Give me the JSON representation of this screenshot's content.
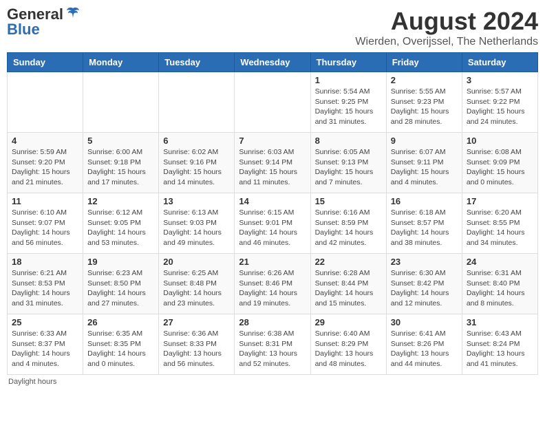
{
  "header": {
    "logo_general": "General",
    "logo_blue": "Blue",
    "title": "August 2024",
    "subtitle": "Wierden, Overijssel, The Netherlands"
  },
  "calendar": {
    "days_of_week": [
      "Sunday",
      "Monday",
      "Tuesday",
      "Wednesday",
      "Thursday",
      "Friday",
      "Saturday"
    ],
    "weeks": [
      [
        {
          "day": "",
          "info": ""
        },
        {
          "day": "",
          "info": ""
        },
        {
          "day": "",
          "info": ""
        },
        {
          "day": "",
          "info": ""
        },
        {
          "day": "1",
          "info": "Sunrise: 5:54 AM\nSunset: 9:25 PM\nDaylight: 15 hours\nand 31 minutes."
        },
        {
          "day": "2",
          "info": "Sunrise: 5:55 AM\nSunset: 9:23 PM\nDaylight: 15 hours\nand 28 minutes."
        },
        {
          "day": "3",
          "info": "Sunrise: 5:57 AM\nSunset: 9:22 PM\nDaylight: 15 hours\nand 24 minutes."
        }
      ],
      [
        {
          "day": "4",
          "info": "Sunrise: 5:59 AM\nSunset: 9:20 PM\nDaylight: 15 hours\nand 21 minutes."
        },
        {
          "day": "5",
          "info": "Sunrise: 6:00 AM\nSunset: 9:18 PM\nDaylight: 15 hours\nand 17 minutes."
        },
        {
          "day": "6",
          "info": "Sunrise: 6:02 AM\nSunset: 9:16 PM\nDaylight: 15 hours\nand 14 minutes."
        },
        {
          "day": "7",
          "info": "Sunrise: 6:03 AM\nSunset: 9:14 PM\nDaylight: 15 hours\nand 11 minutes."
        },
        {
          "day": "8",
          "info": "Sunrise: 6:05 AM\nSunset: 9:13 PM\nDaylight: 15 hours\nand 7 minutes."
        },
        {
          "day": "9",
          "info": "Sunrise: 6:07 AM\nSunset: 9:11 PM\nDaylight: 15 hours\nand 4 minutes."
        },
        {
          "day": "10",
          "info": "Sunrise: 6:08 AM\nSunset: 9:09 PM\nDaylight: 15 hours\nand 0 minutes."
        }
      ],
      [
        {
          "day": "11",
          "info": "Sunrise: 6:10 AM\nSunset: 9:07 PM\nDaylight: 14 hours\nand 56 minutes."
        },
        {
          "day": "12",
          "info": "Sunrise: 6:12 AM\nSunset: 9:05 PM\nDaylight: 14 hours\nand 53 minutes."
        },
        {
          "day": "13",
          "info": "Sunrise: 6:13 AM\nSunset: 9:03 PM\nDaylight: 14 hours\nand 49 minutes."
        },
        {
          "day": "14",
          "info": "Sunrise: 6:15 AM\nSunset: 9:01 PM\nDaylight: 14 hours\nand 46 minutes."
        },
        {
          "day": "15",
          "info": "Sunrise: 6:16 AM\nSunset: 8:59 PM\nDaylight: 14 hours\nand 42 minutes."
        },
        {
          "day": "16",
          "info": "Sunrise: 6:18 AM\nSunset: 8:57 PM\nDaylight: 14 hours\nand 38 minutes."
        },
        {
          "day": "17",
          "info": "Sunrise: 6:20 AM\nSunset: 8:55 PM\nDaylight: 14 hours\nand 34 minutes."
        }
      ],
      [
        {
          "day": "18",
          "info": "Sunrise: 6:21 AM\nSunset: 8:53 PM\nDaylight: 14 hours\nand 31 minutes."
        },
        {
          "day": "19",
          "info": "Sunrise: 6:23 AM\nSunset: 8:50 PM\nDaylight: 14 hours\nand 27 minutes."
        },
        {
          "day": "20",
          "info": "Sunrise: 6:25 AM\nSunset: 8:48 PM\nDaylight: 14 hours\nand 23 minutes."
        },
        {
          "day": "21",
          "info": "Sunrise: 6:26 AM\nSunset: 8:46 PM\nDaylight: 14 hours\nand 19 minutes."
        },
        {
          "day": "22",
          "info": "Sunrise: 6:28 AM\nSunset: 8:44 PM\nDaylight: 14 hours\nand 15 minutes."
        },
        {
          "day": "23",
          "info": "Sunrise: 6:30 AM\nSunset: 8:42 PM\nDaylight: 14 hours\nand 12 minutes."
        },
        {
          "day": "24",
          "info": "Sunrise: 6:31 AM\nSunset: 8:40 PM\nDaylight: 14 hours\nand 8 minutes."
        }
      ],
      [
        {
          "day": "25",
          "info": "Sunrise: 6:33 AM\nSunset: 8:37 PM\nDaylight: 14 hours\nand 4 minutes."
        },
        {
          "day": "26",
          "info": "Sunrise: 6:35 AM\nSunset: 8:35 PM\nDaylight: 14 hours\nand 0 minutes."
        },
        {
          "day": "27",
          "info": "Sunrise: 6:36 AM\nSunset: 8:33 PM\nDaylight: 13 hours\nand 56 minutes."
        },
        {
          "day": "28",
          "info": "Sunrise: 6:38 AM\nSunset: 8:31 PM\nDaylight: 13 hours\nand 52 minutes."
        },
        {
          "day": "29",
          "info": "Sunrise: 6:40 AM\nSunset: 8:29 PM\nDaylight: 13 hours\nand 48 minutes."
        },
        {
          "day": "30",
          "info": "Sunrise: 6:41 AM\nSunset: 8:26 PM\nDaylight: 13 hours\nand 44 minutes."
        },
        {
          "day": "31",
          "info": "Sunrise: 6:43 AM\nSunset: 8:24 PM\nDaylight: 13 hours\nand 41 minutes."
        }
      ]
    ]
  },
  "footer": {
    "note": "Daylight hours"
  }
}
